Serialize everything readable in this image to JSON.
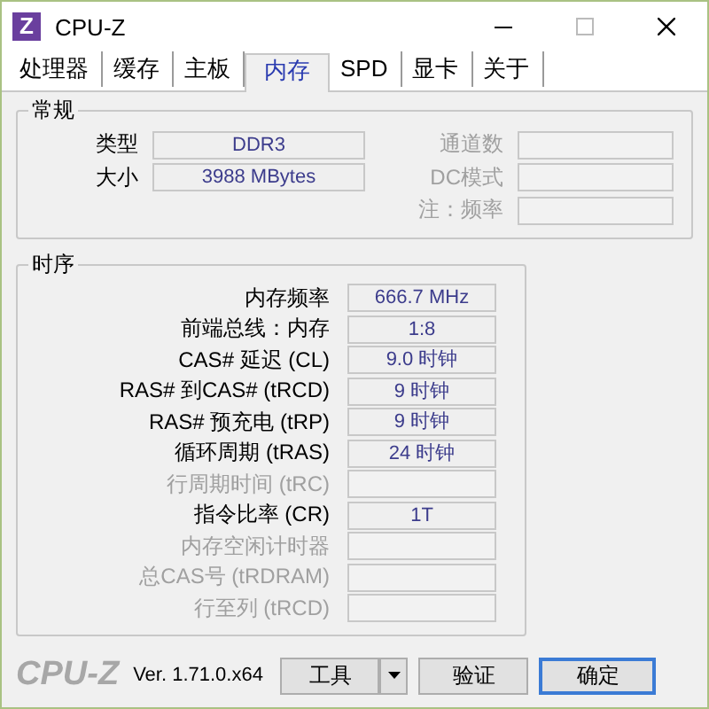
{
  "window": {
    "logo_letter": "Z",
    "title": "CPU-Z"
  },
  "tabs": [
    {
      "label": "处理器",
      "selected": false
    },
    {
      "label": "缓存",
      "selected": false
    },
    {
      "label": "主板",
      "selected": false
    },
    {
      "label": "内存",
      "selected": true
    },
    {
      "label": "SPD",
      "selected": false
    },
    {
      "label": "显卡",
      "selected": false
    },
    {
      "label": "关于",
      "selected": false
    }
  ],
  "general": {
    "title": "常规",
    "left_fields": [
      {
        "label": "类型",
        "value": "DDR3",
        "disabled": false
      },
      {
        "label": "大小",
        "value": "3988 MBytes",
        "disabled": false
      }
    ],
    "right_fields": [
      {
        "label": "通道数",
        "disabled": true
      },
      {
        "label": "DC模式",
        "disabled": true
      },
      {
        "label": "注：频率",
        "disabled": true
      }
    ]
  },
  "timings": {
    "title": "时序",
    "rows": [
      {
        "label": "内存频率",
        "value": "666.7 MHz",
        "disabled": false
      },
      {
        "label": "前端总线：内存",
        "value": "1:8",
        "disabled": false
      },
      {
        "label": "CAS# 延迟 (CL)",
        "value": "9.0 时钟",
        "disabled": false
      },
      {
        "label": "RAS# 到CAS#  (tRCD)",
        "value": "9 时钟",
        "disabled": false
      },
      {
        "label": "RAS# 预充电 (tRP)",
        "value": "9 时钟",
        "disabled": false
      },
      {
        "label": "循环周期 (tRAS)",
        "value": "24 时钟",
        "disabled": false
      },
      {
        "label": "行周期时间 (tRC)",
        "disabled": true
      },
      {
        "label": "指令比率 (CR)",
        "value": "1T",
        "disabled": false
      },
      {
        "label": "内存空闲计时器",
        "disabled": true
      },
      {
        "label": "总CAS号 (tRDRAM)",
        "disabled": true
      },
      {
        "label": "行至列 (tRCD)",
        "disabled": true
      }
    ]
  },
  "footer": {
    "brand": "CPU-Z",
    "version": "Ver. 1.71.0.x64",
    "buttons": [
      {
        "kind": "menu",
        "label": "工具"
      },
      {
        "kind": "plain",
        "label": "验证"
      },
      {
        "kind": "default",
        "label": "确定"
      }
    ]
  }
}
